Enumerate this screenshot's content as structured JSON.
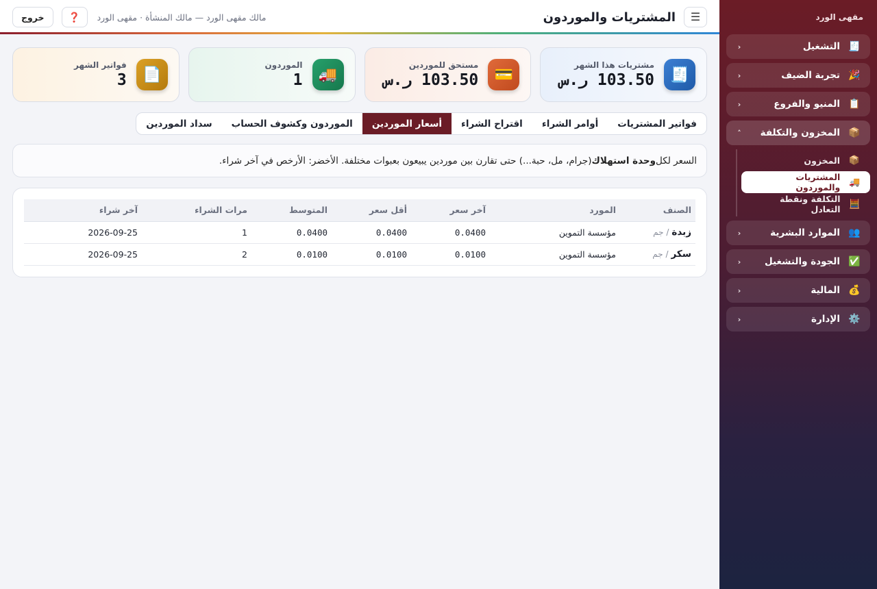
{
  "sidebar": {
    "brand": "مقهى الورد",
    "groups": [
      {
        "label": "التشغيل",
        "icon": "🧾",
        "chevron": "‹"
      },
      {
        "label": "تجربة الضيف",
        "icon": "🎉",
        "chevron": "‹"
      },
      {
        "label": "المنيو والفروع",
        "icon": "📋",
        "chevron": "‹"
      },
      {
        "label": "المخزون والتكلفة",
        "icon": "📦",
        "chevron": "˄"
      },
      {
        "label": "الموارد البشرية",
        "icon": "👥",
        "chevron": "‹"
      },
      {
        "label": "الجودة والتشغيل",
        "icon": "✅",
        "chevron": "‹"
      },
      {
        "label": "المالية",
        "icon": "💰",
        "chevron": "‹"
      },
      {
        "label": "الإدارة",
        "icon": "⚙️",
        "chevron": "‹"
      }
    ],
    "sub_items": [
      {
        "label": "المخزون",
        "icon": "📦"
      },
      {
        "label": "المشتريات والموردون",
        "icon": "🚚"
      },
      {
        "label": "التكلفة ونقطة التعادل",
        "icon": "🧮"
      }
    ]
  },
  "topbar": {
    "menu_icon": "☰",
    "title": "المشتريات والموردون",
    "subtitle": "مالك مقهى الورد — مالك المنشأة · مقهى الورد",
    "help_icon": "❓",
    "logout": "خروج"
  },
  "stats": [
    {
      "label": "مشتريات هذا الشهر",
      "value": "103.50 ر.س",
      "icon": "🧾"
    },
    {
      "label": "مستحق للموردين",
      "value": "103.50 ر.س",
      "icon": "💳"
    },
    {
      "label": "الموردون",
      "value": "1",
      "icon": "🚚"
    },
    {
      "label": "فواتير الشهر",
      "value": "3",
      "icon": "📄"
    }
  ],
  "tabs": [
    "فواتير المشتريات",
    "أوامر الشراء",
    "اقتراح الشراء",
    "أسعار الموردين",
    "الموردون وكشوف الحساب",
    "سداد الموردين"
  ],
  "active_tab": "أسعار الموردين",
  "note": {
    "before": "السعر لكل ",
    "bold": "وحدة استهلاك",
    "after": " (جرام، مل، حبة...) حتى تقارن بين موردين يبيعون بعبوات مختلفة. الأخضر: الأرخص في آخر شراء."
  },
  "table": {
    "headers": [
      "الصنف",
      "المورد",
      "آخر سعر",
      "أقل سعر",
      "المتوسط",
      "مرات الشراء",
      "آخر شراء"
    ],
    "rows": [
      {
        "item": "زبدة",
        "unit": "/ جم",
        "supplier": "مؤسسة التموين",
        "last_price": "0.0400",
        "min_price": "0.0400",
        "avg": "0.0400",
        "count": "1",
        "last_date": "2026-09-25"
      },
      {
        "item": "سكر",
        "unit": "/ جم",
        "supplier": "مؤسسة التموين",
        "last_price": "0.0100",
        "min_price": "0.0100",
        "avg": "0.0100",
        "count": "2",
        "last_date": "2026-09-25"
      }
    ]
  },
  "colors": {
    "sidebar_top": "#6b1c26",
    "sidebar_bottom": "#1c2340",
    "active_tab": "#6b1c26"
  }
}
